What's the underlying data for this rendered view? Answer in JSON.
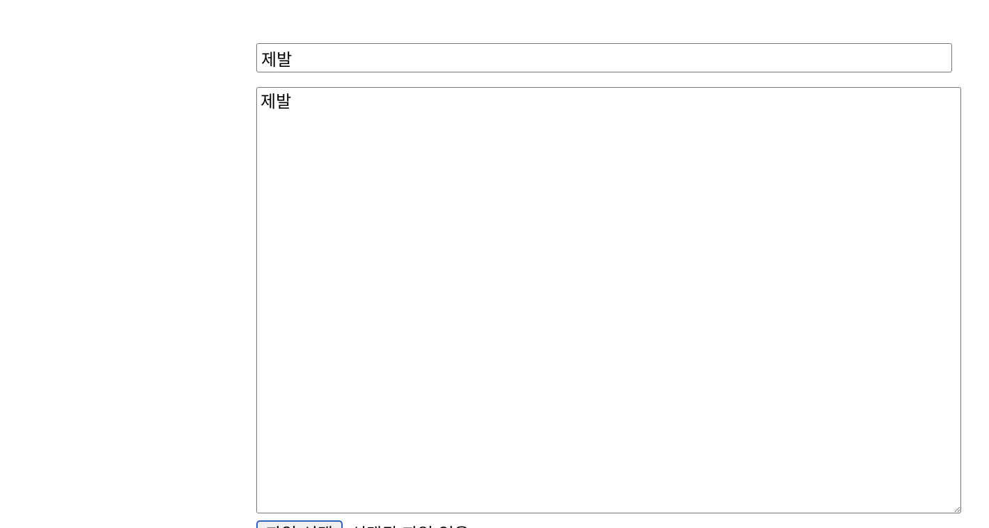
{
  "form": {
    "title_value": "제발",
    "content_value": "제발",
    "file_button_label": "파일 선택",
    "file_status": "선택된 파일 없음"
  }
}
